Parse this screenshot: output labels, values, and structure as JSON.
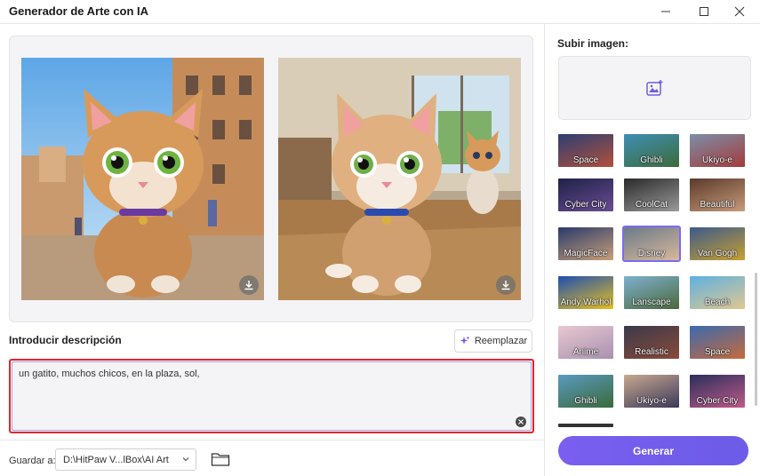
{
  "window": {
    "title": "Generador de Arte con IA"
  },
  "preview": {},
  "description": {
    "label": "Introducir descripción",
    "replace_label": "Reemplazar",
    "text": "un gatito, muchos chicos, en la plaza, sol,"
  },
  "save": {
    "label": "Guardar a:",
    "path": "D:\\HitPaw V...lBox\\AI Art"
  },
  "sidebar": {
    "upload_label": "Subir imagen:",
    "styles": [
      {
        "label": "Space",
        "c1": "#2b3f73",
        "c2": "#b44f3b"
      },
      {
        "label": "Ghibli",
        "c1": "#3f8fb5",
        "c2": "#3c6b3a"
      },
      {
        "label": "Ukiyo-e",
        "c1": "#7a8fa8",
        "c2": "#a63a3a"
      },
      {
        "label": "Cyber City",
        "c1": "#1e2247",
        "c2": "#6a4c93"
      },
      {
        "label": "CoolCat",
        "c1": "#2a2a2a",
        "c2": "#9a9a9a"
      },
      {
        "label": "Beautiful",
        "c1": "#5a3a2a",
        "c2": "#c89a7a"
      },
      {
        "label": "MagicFace",
        "c1": "#2a3a6a",
        "c2": "#c9a07a"
      },
      {
        "label": "Disney",
        "c1": "#6b7a8a",
        "c2": "#d9b89a"
      },
      {
        "label": "Van Gogh",
        "c1": "#3a5a8a",
        "c2": "#c9a030"
      },
      {
        "label": "Andy Warhol",
        "c1": "#1f4fb0",
        "c2": "#e8c020"
      },
      {
        "label": "Lanscape",
        "c1": "#7fb0d0",
        "c2": "#4a6a3a"
      },
      {
        "label": "Beach",
        "c1": "#5fb0e0",
        "c2": "#e0c890"
      },
      {
        "label": "Anime",
        "c1": "#e8c8d0",
        "c2": "#a890b0"
      },
      {
        "label": "Realistic",
        "c1": "#3a3a4a",
        "c2": "#8a4a3a"
      },
      {
        "label": "Space",
        "c1": "#3a6ab0",
        "c2": "#c86a3a"
      },
      {
        "label": "Ghibli",
        "c1": "#5a9ac0",
        "c2": "#3a6a3a"
      },
      {
        "label": "Ukiyo-e",
        "c1": "#c8a890",
        "c2": "#3a3a5a"
      },
      {
        "label": "Cyber City",
        "c1": "#2a2e5a",
        "c2": "#c05a8a"
      }
    ],
    "selected_style": "Disney",
    "generate_label": "Generar",
    "accent": "#6c5ce7"
  }
}
